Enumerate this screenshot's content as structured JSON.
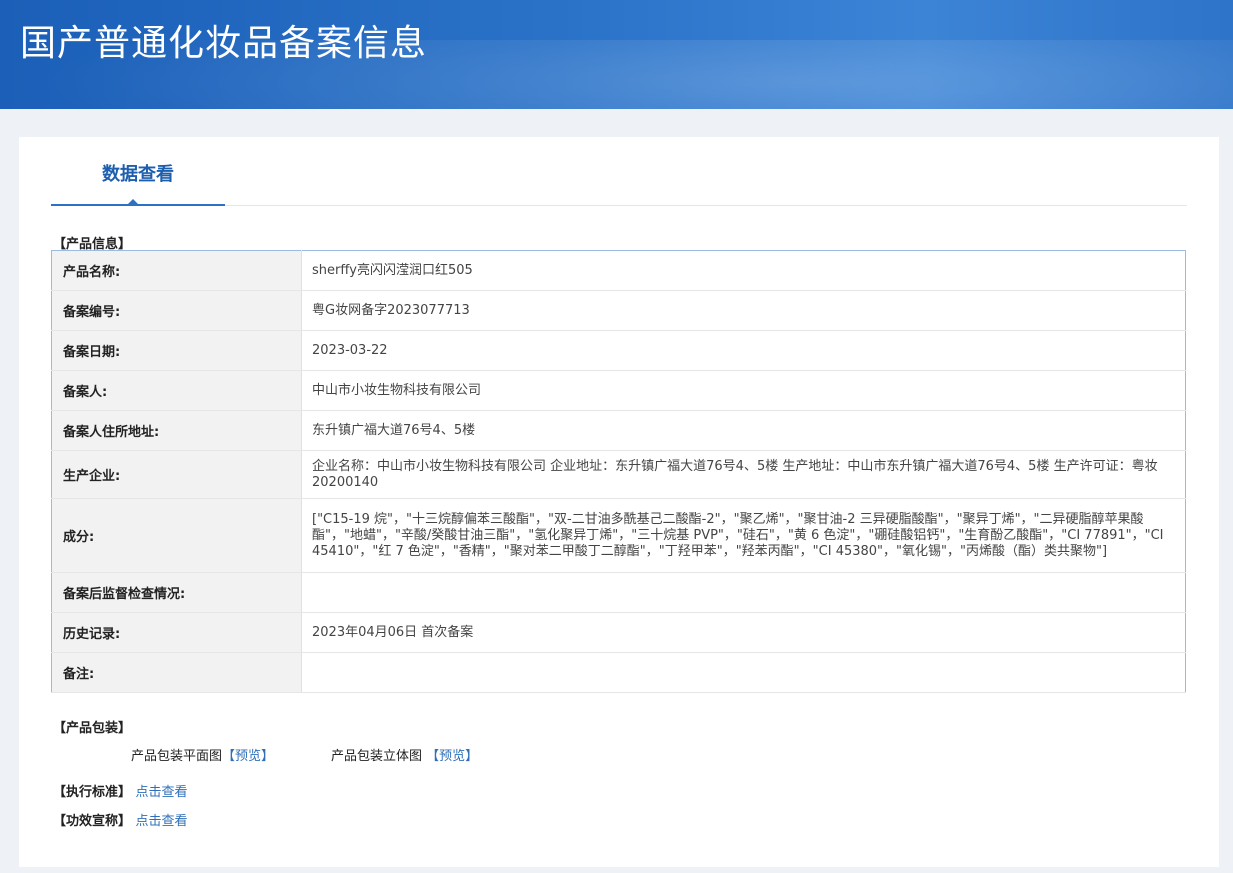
{
  "header": {
    "title": "国产普通化妆品备案信息"
  },
  "tabs": [
    {
      "label": "数据查看"
    }
  ],
  "product_info": {
    "section_title": "【产品信息】",
    "rows": [
      {
        "key": "产品名称:",
        "value": "sherffy亮闪闪滢润口红505"
      },
      {
        "key": "备案编号:",
        "value": "粤G妆网备字2023077713"
      },
      {
        "key": "备案日期:",
        "value": "2023-03-22"
      },
      {
        "key": "备案人:",
        "value": "中山市小妆生物科技有限公司"
      },
      {
        "key": "备案人住所地址:",
        "value": "东升镇广福大道76号4、5楼"
      },
      {
        "key": "生产企业:",
        "value": "企业名称：中山市小妆生物科技有限公司 企业地址：东升镇广福大道76号4、5楼 生产地址：中山市东升镇广福大道76号4、5楼 生产许可证：粤妆20200140"
      },
      {
        "key": "成分:",
        "value": "[\"C15-19 烷\"，\"十三烷醇偏苯三酸酯\"，\"双-二甘油多酰基己二酸酯-2\"，\"聚乙烯\"，\"聚甘油-2 三异硬脂酸酯\"，\"聚异丁烯\"，\"二异硬脂醇苹果酸酯\"，\"地蜡\"，\"辛酸/癸酸甘油三酯\"，\"氢化聚异丁烯\"，\"三十烷基 PVP\"，\"硅石\"，\"黄 6 色淀\"，\"硼硅酸铝钙\"，\"生育酚乙酸酯\"，\"CI 77891\"，\"CI 45410\"，\"红 7 色淀\"，\"香精\"，\"聚对苯二甲酸丁二醇酯\"，\"丁羟甲苯\"，\"羟苯丙酯\"，\"CI 45380\"，\"氧化锡\"，\"丙烯酸（酯）类共聚物\"]"
      },
      {
        "key": "备案后监督检查情况:",
        "value": ""
      },
      {
        "key": "历史记录:",
        "value": "2023年04月06日 首次备案"
      },
      {
        "key": "备注:",
        "value": ""
      }
    ]
  },
  "packaging": {
    "section_title": "【产品包装】",
    "flat_label": "产品包装平面图",
    "flat_link": "【预览】",
    "solid_label": "产品包装立体图",
    "solid_link": "【预览】"
  },
  "standard": {
    "label": "【执行标准】",
    "link": "点击查看"
  },
  "efficacy": {
    "label": "【功效宣称】",
    "link": "点击查看"
  }
}
